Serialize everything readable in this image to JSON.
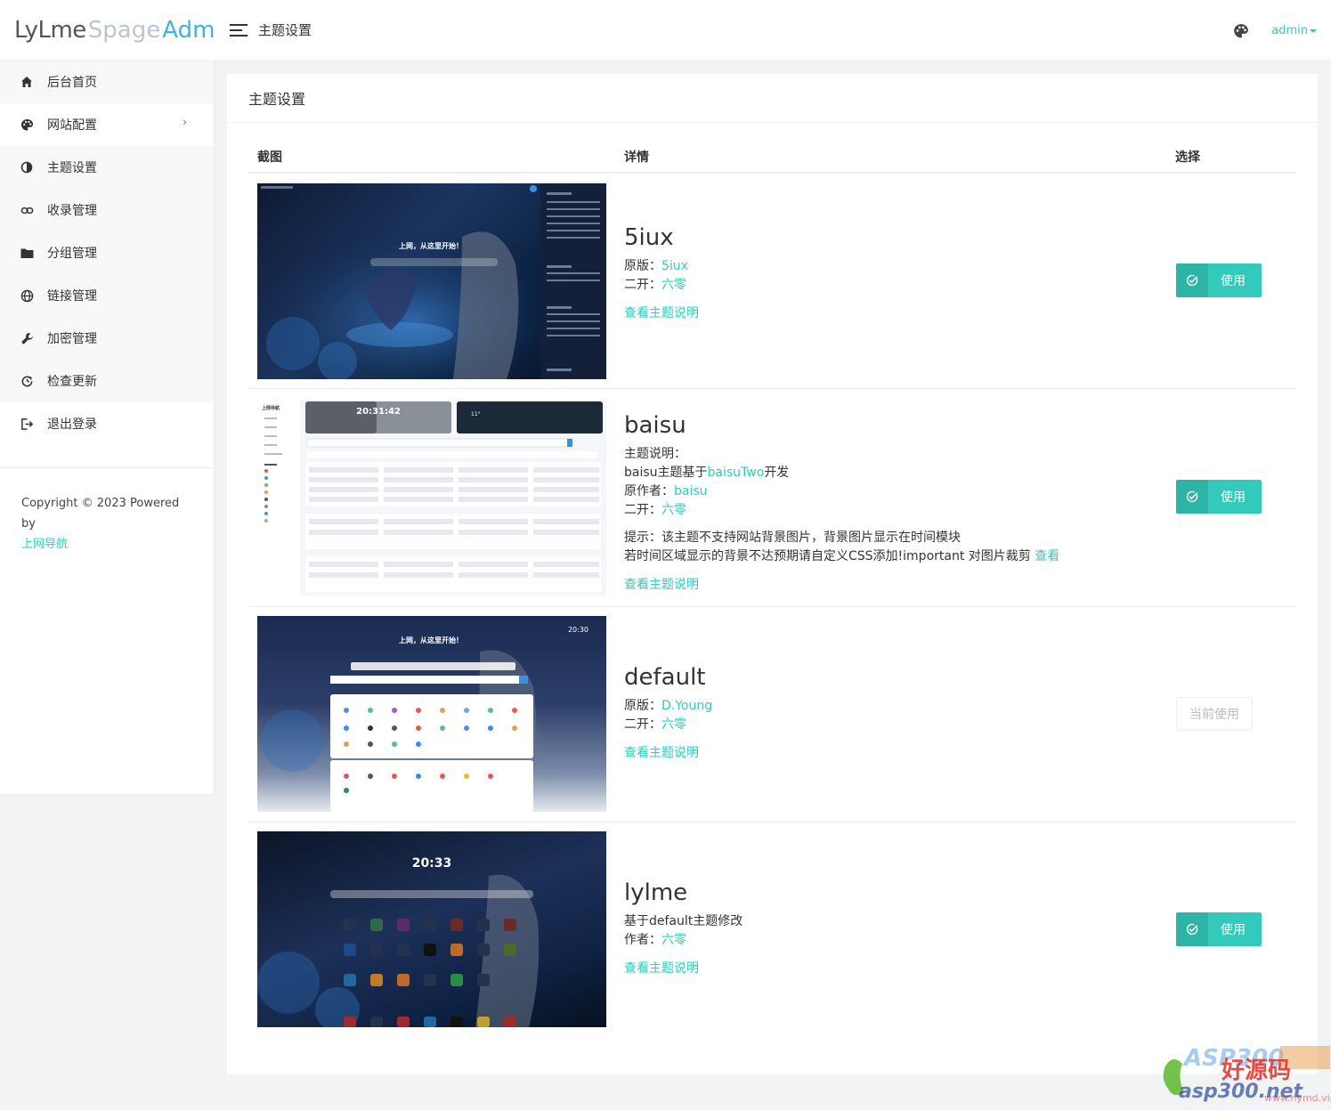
{
  "logo": {
    "part1": "LyLme",
    "part2": "Spage",
    "part3": "Admin"
  },
  "sidebar": {
    "items": [
      {
        "label": "后台首页",
        "icon": "home-icon"
      },
      {
        "label": "网站配置",
        "icon": "palette-icon",
        "has_arrow": true
      },
      {
        "label": "主题设置",
        "icon": "contrast-icon"
      },
      {
        "label": "收录管理",
        "icon": "link-icon"
      },
      {
        "label": "分组管理",
        "icon": "folder-icon"
      },
      {
        "label": "链接管理",
        "icon": "globe-icon"
      },
      {
        "label": "加密管理",
        "icon": "wrench-icon"
      },
      {
        "label": "检查更新",
        "icon": "refresh-icon"
      },
      {
        "label": "退出登录",
        "icon": "logout-icon"
      }
    ],
    "copyright": "Copyright © 2023 Powered by",
    "copyright_link": "上网导航"
  },
  "header": {
    "title": "主题设置",
    "user": "admin"
  },
  "card": {
    "title": "主题设置"
  },
  "table": {
    "headers": {
      "screenshot": "截图",
      "details": "详情",
      "select": "选择"
    }
  },
  "themes": [
    {
      "name": "5iux",
      "origin_label": "原版：",
      "origin": "5iux",
      "mod_label": "二开：",
      "mod": "六零",
      "doc_link": "查看主题说明",
      "button": "使用",
      "preview_slogan": "上网，从这里开始！"
    },
    {
      "name": "baisu",
      "desc_label": "主题说明：",
      "desc_pre": "baisu主题基于",
      "desc_link": "baisuTwo",
      "desc_post": "开发",
      "author_label": "原作者：",
      "author": "baisu",
      "mod_label": "二开：",
      "mod": "六零",
      "tip1": "提示：该主题不支持网站背景图片，背景图片显示在时间模块",
      "tip2": "若时间区域显示的背景不达预期请自定义CSS添加!important 对图片裁剪",
      "tip_link": "查看",
      "doc_link": "查看主题说明",
      "button": "使用",
      "preview_time": "20:31:42",
      "preview_brand": "上网导航",
      "preview_temp": "11°"
    },
    {
      "name": "default",
      "origin_label": "原版：",
      "origin": "D.Young",
      "mod_label": "二开：",
      "mod": "六零",
      "doc_link": "查看主题说明",
      "button": "当前使用",
      "preview_slogan": "上网，从这里开始！",
      "preview_time": "20:30"
    },
    {
      "name": "lylme",
      "desc": "基于default主题修改",
      "author_label": "作者：",
      "author": "六零",
      "doc_link": "查看主题说明",
      "button": "使用",
      "preview_time": "20:33"
    }
  ],
  "watermark": {
    "text1": "ASP300",
    "text2": "好源码",
    "text3": "asp300.net",
    "text4": "www.nymd.vip"
  },
  "colors": {
    "accent": "#33cabb",
    "logo_blue": "#3bb4e5"
  }
}
